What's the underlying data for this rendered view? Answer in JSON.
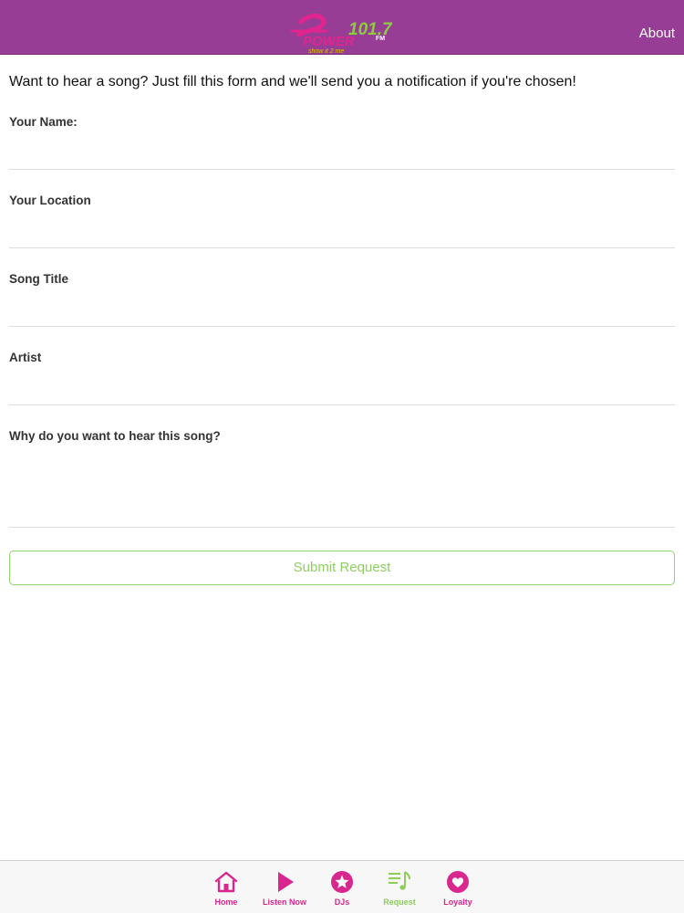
{
  "header": {
    "about_label": "About",
    "logo_text": {
      "brand": "POWER",
      "frequency": "101.7",
      "unit": "FM",
      "tagline": "show it 2 me"
    },
    "colors": {
      "bar": "#973d96",
      "logo_pink": "#e0258f",
      "logo_green": "#8ccd3f"
    }
  },
  "form": {
    "intro": "Want to hear a song? Just fill this form and we'll send you a notification if you're chosen!",
    "fields": [
      {
        "label": "Your Name:",
        "value": ""
      },
      {
        "label": "Your Location",
        "value": ""
      },
      {
        "label": "Song Title",
        "value": ""
      },
      {
        "label": "Artist",
        "value": ""
      },
      {
        "label": "Why do you want to hear this song?",
        "value": ""
      }
    ],
    "submit_label": "Submit Request"
  },
  "tabbar": {
    "items": [
      {
        "label": "Home",
        "icon": "home-icon",
        "active": false
      },
      {
        "label": "Listen Now",
        "icon": "play-icon",
        "active": false
      },
      {
        "label": "DJs",
        "icon": "star-icon",
        "active": false
      },
      {
        "label": "Request",
        "icon": "music-list-icon",
        "active": true
      },
      {
        "label": "Loyalty",
        "icon": "heart-icon",
        "active": false
      }
    ],
    "colors": {
      "inactive": "#d8288f",
      "active": "#8ccd5c"
    }
  }
}
